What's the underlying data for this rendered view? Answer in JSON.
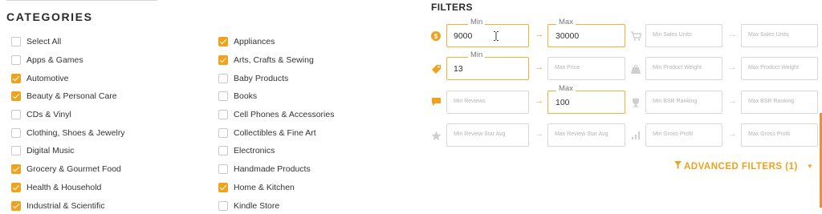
{
  "categories": {
    "title": "CATEGORIES",
    "left": [
      {
        "label": "Select All",
        "checked": false
      },
      {
        "label": "Apps & Games",
        "checked": false
      },
      {
        "label": "Automotive",
        "checked": true
      },
      {
        "label": "Beauty & Personal Care",
        "checked": true
      },
      {
        "label": "CDs & Vinyl",
        "checked": false
      },
      {
        "label": "Clothing, Shoes & Jewelry",
        "checked": false
      },
      {
        "label": "Digital Music",
        "checked": false
      },
      {
        "label": "Grocery & Gourmet Food",
        "checked": true
      },
      {
        "label": "Health & Household",
        "checked": true
      },
      {
        "label": "Industrial & Scientific",
        "checked": true
      }
    ],
    "right": [
      {
        "label": "Appliances",
        "checked": true
      },
      {
        "label": "Arts, Crafts & Sewing",
        "checked": true
      },
      {
        "label": "Baby Products",
        "checked": false
      },
      {
        "label": "Books",
        "checked": false
      },
      {
        "label": "Cell Phones & Accessories",
        "checked": false
      },
      {
        "label": "Collectibles & Fine Art",
        "checked": false
      },
      {
        "label": "Electronics",
        "checked": false
      },
      {
        "label": "Handmade Products",
        "checked": false
      },
      {
        "label": "Home & Kitchen",
        "checked": true
      },
      {
        "label": "Kindle Store",
        "checked": false
      }
    ]
  },
  "filters": {
    "title": "FILTERS",
    "price_min": {
      "label": "Min",
      "value": "9000"
    },
    "price_max": {
      "label": "Max",
      "value": "30000"
    },
    "sales_min_placeholder": "Min Sales Units",
    "sales_max_placeholder": "Max Sales Units",
    "tag_min": {
      "label": "Min",
      "value": "13"
    },
    "tag_max_placeholder": "Max Price",
    "weight_min_placeholder": "Min Product Weight",
    "weight_max_placeholder": "Max Product Weight",
    "reviews_min_placeholder": "Min Reviews",
    "reviews_max": {
      "label": "Max",
      "value": "100"
    },
    "bsr_min_placeholder": "Min BSR Ranking",
    "bsr_max_placeholder": "Max BSR Ranking",
    "star_min_placeholder": "Min Review Star Avg",
    "star_max_placeholder": "Max Review Star Avg",
    "profit_min_placeholder": "Min Gross Profit",
    "profit_max_placeholder": "Max Gross Profit",
    "arrow": "→",
    "advanced_label": "ADVANCED FILTERS (1)",
    "advanced_caret": "▼"
  },
  "colors": {
    "accent": "#f0a21d",
    "border": "#d8d8d8",
    "active_border": "#f0b03a",
    "side_bar": "#f08c3a"
  },
  "icons": [
    "dollar-coin-icon",
    "cart-icon",
    "price-tag-icon",
    "weight-icon",
    "comment-icon",
    "trophy-icon",
    "star-icon",
    "bar-chart-icon",
    "funnel-icon",
    "text-cursor-icon"
  ]
}
